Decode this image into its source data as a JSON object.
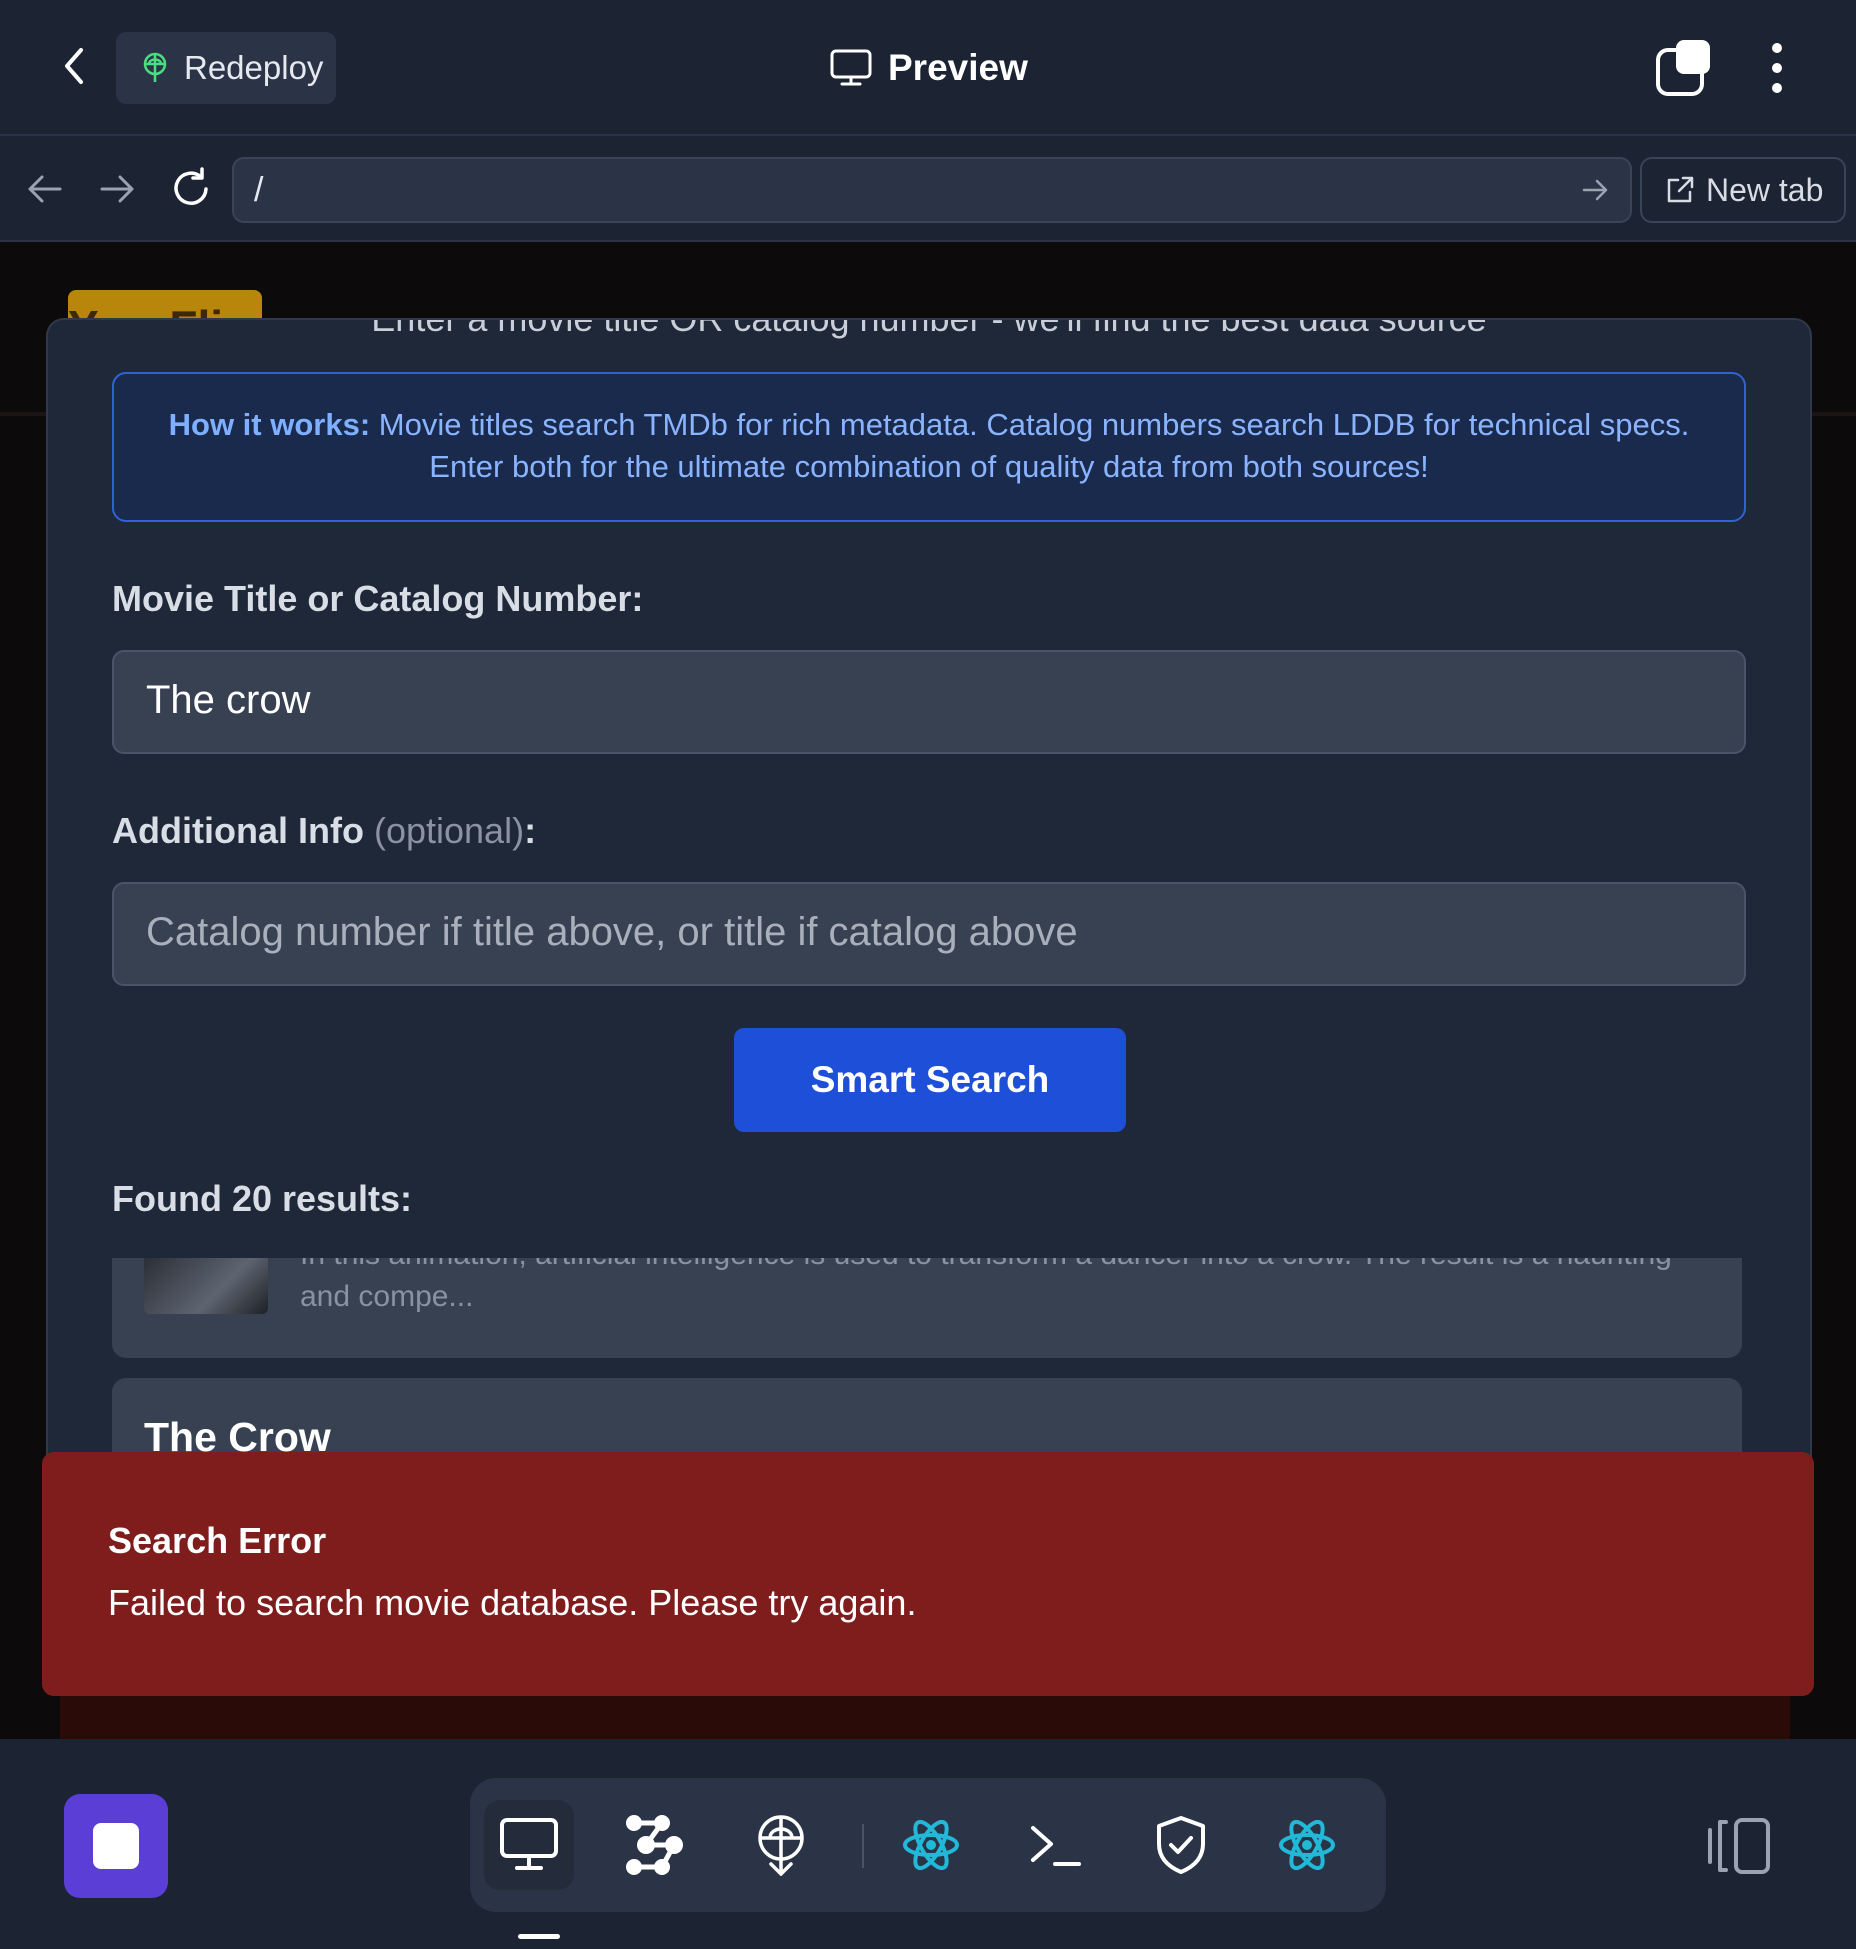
{
  "topbar": {
    "redeploy_label": "Redeploy",
    "title": "Preview"
  },
  "browser": {
    "url": "/",
    "new_tab_label": "New tab"
  },
  "background_app": {
    "logo_text": "YourFlix"
  },
  "modal": {
    "cut_subtitle": "Enter a movie title OR catalog number - we'll find the best data source",
    "info": {
      "heading": "How it works:",
      "line1": "Movie titles search TMDb for rich metadata. Catalog numbers search LDDB for technical specs.",
      "line2": "Enter both for the ultimate combination of quality data from both sources!"
    },
    "title_field": {
      "label": "Movie Title or Catalog Number:",
      "value": "The crow"
    },
    "additional_field": {
      "label": "Additional Info",
      "optional": "(optional)",
      "colon": ":",
      "placeholder": "Catalog number if title above, or title if catalog above"
    },
    "search_button": "Smart Search",
    "results_label": "Found 20 results:",
    "results": [
      {
        "description": "In this animation, artificial intelligence is used to transform a dancer into a crow. The result is a haunting and compe..."
      },
      {
        "title": "The Crow"
      }
    ]
  },
  "toast": {
    "title": "Search Error",
    "message": "Failed to search movie database. Please try again."
  },
  "dock": {
    "items": [
      "monitor-icon",
      "network-icon",
      "deploy-icon",
      "react-icon",
      "terminal-icon",
      "shield-icon",
      "react-icon"
    ]
  },
  "colors": {
    "error": "#7f1d1d",
    "primary_button": "#1e4fd8",
    "stop_button": "#5b3ed6",
    "info_border": "#2f62d6"
  }
}
